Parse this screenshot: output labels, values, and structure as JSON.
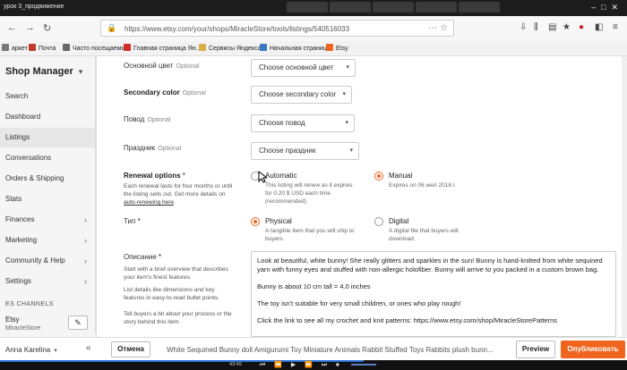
{
  "player": {
    "title": "урок 3_продвижение"
  },
  "browser": {
    "url": "https://www.etsy.com/your/shops/MiracleStore/tools/listings/540516033",
    "bookmarks": [
      {
        "label": "аркет",
        "icon": "bookmark-icon",
        "color": "#777777"
      },
      {
        "label": "Почта",
        "icon": "mail-icon",
        "color": "#c0392b"
      },
      {
        "label": "Часто посещаемые",
        "icon": "gear-icon",
        "color": "#666666"
      },
      {
        "label": "Главная страница Ян...",
        "icon": "yandex-icon",
        "color": "#d62b2b"
      },
      {
        "label": "Сервисы Яндекса",
        "icon": "folder-icon",
        "color": "#d8b04a"
      },
      {
        "label": "Начальная страница",
        "icon": "home-icon",
        "color": "#3a78c2"
      },
      {
        "label": "Etsy",
        "icon": "etsy-icon",
        "color": "#f1641e"
      }
    ]
  },
  "sidebar": {
    "title": "Shop Manager",
    "items": [
      {
        "label": "Search",
        "chevron": false,
        "active": false
      },
      {
        "label": "Dashboard",
        "chevron": false,
        "active": false
      },
      {
        "label": "Listings",
        "chevron": false,
        "active": true
      },
      {
        "label": "Conversations",
        "chevron": false,
        "active": false
      },
      {
        "label": "Orders & Shipping",
        "chevron": false,
        "active": false
      },
      {
        "label": "Stats",
        "chevron": false,
        "active": false
      },
      {
        "label": "Finances",
        "chevron": true,
        "active": false
      },
      {
        "label": "Marketing",
        "chevron": true,
        "active": false
      },
      {
        "label": "Community & Help",
        "chevron": true,
        "active": false
      },
      {
        "label": "Settings",
        "chevron": true,
        "active": false
      }
    ],
    "sales_channels_heading": "ES CHANNELS",
    "channel_name": "Etsy",
    "channel_store": "MiracleStore",
    "user": "Anna Karelina"
  },
  "form": {
    "primary_color": {
      "label": "Основной цвет",
      "optional": "Optional",
      "value": "Choose основной цвет"
    },
    "secondary_color": {
      "label": "Secondary color",
      "optional": "Optional",
      "value": "Choose secondary color"
    },
    "occasion": {
      "label": "Повод",
      "optional": "Optional",
      "value": "Choose повод"
    },
    "holiday": {
      "label": "Праздник",
      "optional": "Optional",
      "value": "Choose праздник"
    },
    "renewal": {
      "label": "Renewal options",
      "required_mark": "*",
      "help_text": "Each renewal lasts for four months or until the listing sells out. Get more details on ",
      "help_link": "auto-renewing here",
      "help_end": ".",
      "options": [
        {
          "title": "Automatic",
          "desc": "This listing will renew as it expires for 0.20 $ USD each time (recommended).",
          "selected": false
        },
        {
          "title": "Manual",
          "desc": "Expires on 06 июл 2018 г.",
          "selected": true
        }
      ]
    },
    "type": {
      "label": "Тип",
      "required_mark": "*",
      "options": [
        {
          "title": "Physical",
          "desc": "A tangible item that you will ship to buyers.",
          "selected": true
        },
        {
          "title": "Digital",
          "desc": "A digital file that buyers will download.",
          "selected": false
        }
      ]
    },
    "description": {
      "label": "Описание",
      "required_mark": "*",
      "help": [
        "Start with a brief overview that describes your item's finest features.",
        "List details like dimensions and key features in easy-to-read bullet points.",
        "Tell buyers a bit about your process or the story behind this item."
      ],
      "paragraphs": [
        "Look at beautiful, white bunny! She really glitters and sparkles in the sun! Bunny is hand-knitted from white sequined yarn with funny eyes and stuffed with non-allergic holofiber. Bunny will arrive to you packed in a custom brown bag.",
        "Bunny is about 10 cm tall = 4.0 inches",
        "The toy isn't suitable for very small children, or ones who play rough!",
        "Click the link to see all my crochet and knit patterns: https://www.etsy.com/shop/MiracleStorePatterns"
      ]
    }
  },
  "actions": {
    "cancel": "Отмена",
    "listing_title": "White Sequined Bunny doll Amigurumi Toy Miniature Animals Rabbit Stuffed Toys Rabbits plush bunn...",
    "preview": "Preview",
    "publish": "Опубликовать"
  },
  "playback": {
    "time": "43:49",
    "progress": 0.58
  },
  "colors": {
    "accent": "#f1641e"
  }
}
